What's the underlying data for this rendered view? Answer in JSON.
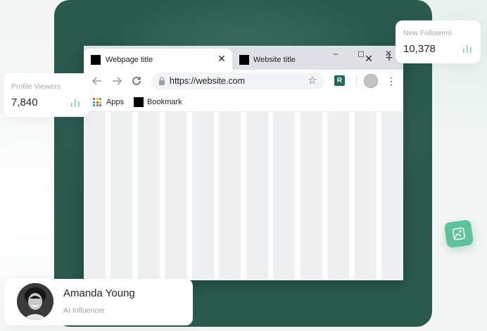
{
  "browser": {
    "tabs": [
      {
        "title": "Webpage title",
        "active": true
      },
      {
        "title": "Website title",
        "active": false
      }
    ],
    "url": "https://website.com",
    "bookmarks": [
      {
        "label": "Apps",
        "icon": "apps-grid-icon"
      },
      {
        "label": "Bookmark",
        "icon": "bookmark-favicon"
      }
    ],
    "extension_glyph": "R"
  },
  "stats": {
    "profile_viewers": {
      "label": "Profile Viewers",
      "value": "7,840"
    },
    "new_followers": {
      "label": "New Followers",
      "value": "10,378"
    }
  },
  "profile": {
    "name": "Amanda Young",
    "role": "AI Influencer"
  },
  "colors": {
    "hero_panel": "#2a5b4f",
    "accent_green": "#5ec39b",
    "chart_icon": "#7fcfae",
    "extension_badge": "#1e6b58"
  }
}
